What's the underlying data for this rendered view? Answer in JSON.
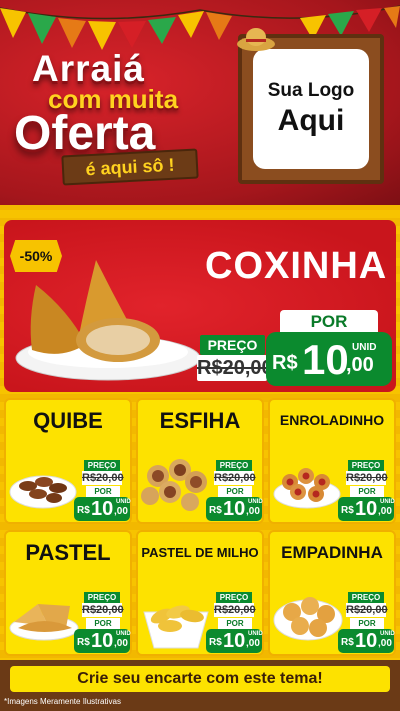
{
  "header": {
    "line1": "Arraiá",
    "line2": "com muita",
    "line3": "Oferta",
    "line4": "é aqui sô !",
    "logo_line1": "Sua Logo",
    "logo_line2": "Aqui"
  },
  "hero": {
    "discount": "-50%",
    "name": "COXINHA",
    "preco_label": "PREÇO",
    "old_price": "R$20,00",
    "por_label": "POR",
    "currency": "R$",
    "price_int": "10",
    "price_cents": ",00",
    "unit": "UNID"
  },
  "cards": [
    {
      "name": "QUIBE",
      "preco_label": "PREÇO",
      "old_price": "R$20,00",
      "por_label": "POR",
      "currency": "R$",
      "price_int": "10",
      "price_cents": ",00",
      "unit": "UNID"
    },
    {
      "name": "ESFIHA",
      "preco_label": "PREÇO",
      "old_price": "R$20,00",
      "por_label": "POR",
      "currency": "R$",
      "price_int": "10",
      "price_cents": ",00",
      "unit": "UNID"
    },
    {
      "name": "ENROLADINHO",
      "preco_label": "PREÇO",
      "old_price": "R$20,00",
      "por_label": "POR",
      "currency": "R$",
      "price_int": "10",
      "price_cents": ",00",
      "unit": "UNID"
    },
    {
      "name": "PASTEL",
      "preco_label": "PREÇO",
      "old_price": "R$20,00",
      "por_label": "POR",
      "currency": "R$",
      "price_int": "10",
      "price_cents": ",00",
      "unit": "UNID"
    },
    {
      "name": "PASTEL DE MILHO",
      "preco_label": "PREÇO",
      "old_price": "R$20,00",
      "por_label": "POR",
      "currency": "R$",
      "price_int": "10",
      "price_cents": ",00",
      "unit": "UNID"
    },
    {
      "name": "EMPADINHA",
      "preco_label": "PREÇO",
      "old_price": "R$20,00",
      "por_label": "POR",
      "currency": "R$",
      "price_int": "10",
      "price_cents": ",00",
      "unit": "UNID"
    }
  ],
  "footer": {
    "cta": "Crie seu encarte com este tema!",
    "disclaimer": "*Imagens Meramente Ilustrativas"
  },
  "colors": {
    "header_red": "#c9151c",
    "accent_yellow": "#fde200",
    "price_green": "#0b8a2e",
    "wood_brown": "#6b3a16"
  }
}
